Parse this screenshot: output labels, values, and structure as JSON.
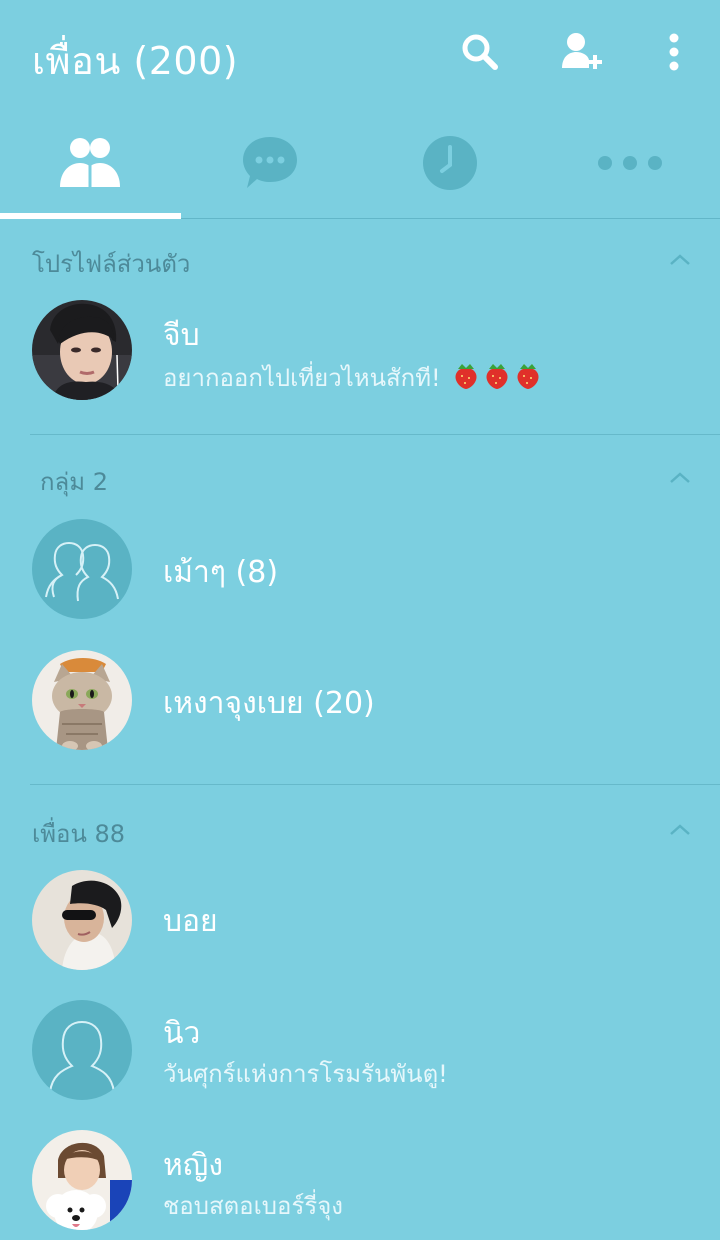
{
  "header": {
    "title": "เพื่อน (200)",
    "icons": [
      "search-icon",
      "add-friend-icon",
      "more-vertical-icon"
    ]
  },
  "tabs": [
    {
      "name": "friends",
      "icon": "friends-icon",
      "active": true
    },
    {
      "name": "chats",
      "icon": "chat-bubble-icon",
      "active": false
    },
    {
      "name": "timeline",
      "icon": "clock-icon",
      "active": false
    },
    {
      "name": "more",
      "icon": "more-horizontal-icon",
      "active": false
    }
  ],
  "sections": {
    "profile": {
      "title": "โปรไฟล์ส่วนตัว",
      "items": [
        {
          "name": "จีบ",
          "status": "อยากออกไปเที่ยวไหนสักที!",
          "status_emoji": "strawberry-icon"
        }
      ]
    },
    "groups": {
      "title": "กลุ่ม 2",
      "items": [
        {
          "name": "เม้าๆ (8)"
        },
        {
          "name": "เหงาจุงเบย (20)"
        }
      ]
    },
    "friends": {
      "title": "เพื่อน 88",
      "items": [
        {
          "name": "บอย"
        },
        {
          "name": "นิว",
          "status": "วันศุกร์แห่งการโรมรันพันตู!"
        },
        {
          "name": "หญิง",
          "status": "ชอบสตอเบอร์รี่จุง"
        }
      ]
    }
  },
  "colors": {
    "background": "#7ccfe0",
    "icon_muted": "#5ab3c4",
    "section_text": "#4d8a99",
    "white": "#ffffff"
  }
}
